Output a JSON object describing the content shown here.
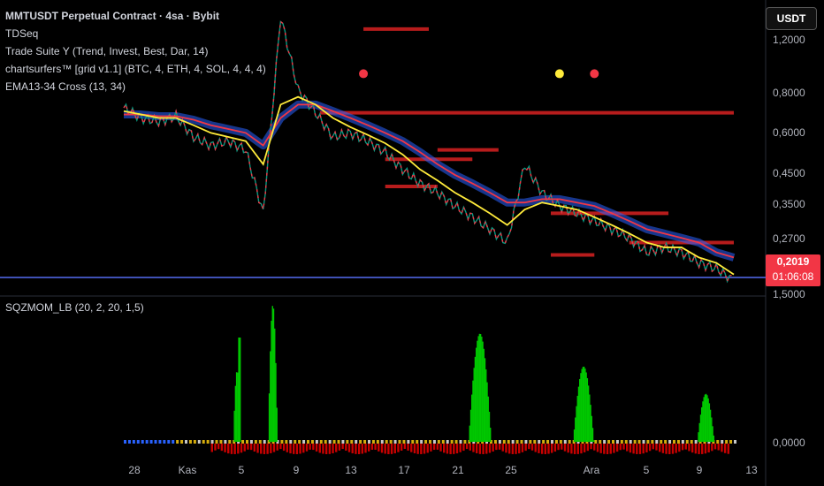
{
  "header": {
    "title": "MMTUSDT Perpetual Contract · 4sa · Bybit",
    "indicators": [
      "TDSeq",
      "Trade Suite Y (Trend, Invest, Best, Dar, 14)",
      "chartsurfers™ [grid v1.1] (BTC, 4, ETH, 4, SOL, 4, 4, 4)",
      "EMA13-34 Cross (13, 34)"
    ],
    "lower_indicator": "SQZMOM_LB (20, 2, 20, 1,5)"
  },
  "currency_button": "USDT",
  "last_price": {
    "value": "0,2019",
    "countdown": "01:06:08"
  },
  "colors": {
    "background": "#000000",
    "up": "#089981",
    "down": "#f23645",
    "ema_fast": "#ffeb3b",
    "ema_slow": "#f23645",
    "cloud": "#2962ff",
    "level": "#b71c1c",
    "mom_up": "#00c800",
    "mom_down": "#c80000",
    "squeeze_on": "#d4ac0d",
    "squeeze_off": "#c8c8c8"
  },
  "chart_data": [
    {
      "type": "line",
      "name": "price",
      "scale": "log",
      "y_ticks": [
        "1,2000",
        "0,8000",
        "0,6000",
        "0,4500",
        "0,3500",
        "0,2700",
        "1,5000"
      ],
      "x_ticks": [
        "28",
        "Kas",
        "5",
        "9",
        "13",
        "17",
        "21",
        "25",
        "Ara",
        "5",
        "9",
        "13"
      ],
      "x": [
        0,
        4,
        8,
        12,
        16,
        20,
        24,
        28,
        32,
        36,
        40,
        44,
        48,
        52,
        56,
        60,
        64,
        68,
        72,
        76,
        80,
        84,
        88,
        92,
        96,
        100,
        104,
        108,
        112,
        116,
        120,
        124,
        128,
        132,
        136,
        140
      ],
      "close": [
        0.78,
        0.72,
        0.7,
        0.73,
        0.62,
        0.58,
        0.6,
        0.56,
        0.34,
        1.6,
        0.9,
        0.75,
        0.62,
        0.64,
        0.6,
        0.55,
        0.48,
        0.43,
        0.4,
        0.36,
        0.33,
        0.3,
        0.27,
        0.5,
        0.4,
        0.36,
        0.34,
        0.32,
        0.3,
        0.28,
        0.25,
        0.26,
        0.25,
        0.23,
        0.22,
        0.2
      ],
      "ema13": [
        0.76,
        0.74,
        0.72,
        0.72,
        0.68,
        0.64,
        0.62,
        0.6,
        0.5,
        0.8,
        0.85,
        0.8,
        0.72,
        0.67,
        0.63,
        0.59,
        0.54,
        0.48,
        0.44,
        0.4,
        0.37,
        0.34,
        0.31,
        0.35,
        0.37,
        0.36,
        0.35,
        0.33,
        0.31,
        0.29,
        0.27,
        0.26,
        0.26,
        0.24,
        0.23,
        0.21
      ],
      "ema34": [
        0.74,
        0.74,
        0.73,
        0.73,
        0.71,
        0.68,
        0.66,
        0.64,
        0.58,
        0.72,
        0.8,
        0.8,
        0.76,
        0.72,
        0.68,
        0.64,
        0.6,
        0.55,
        0.5,
        0.46,
        0.43,
        0.4,
        0.37,
        0.37,
        0.38,
        0.38,
        0.37,
        0.36,
        0.34,
        0.32,
        0.3,
        0.29,
        0.28,
        0.27,
        0.25,
        0.24
      ],
      "levels": [
        {
          "y": 1.45,
          "x0": 55,
          "x1": 70
        },
        {
          "y": 0.75,
          "x0": 45,
          "x1": 140
        },
        {
          "y": 0.56,
          "x0": 72,
          "x1": 86
        },
        {
          "y": 0.52,
          "x0": 60,
          "x1": 80
        },
        {
          "y": 0.42,
          "x0": 60,
          "x1": 72
        },
        {
          "y": 0.34,
          "x0": 98,
          "x1": 125
        },
        {
          "y": 0.27,
          "x0": 116,
          "x1": 140
        },
        {
          "y": 0.245,
          "x0": 98,
          "x1": 108
        }
      ],
      "markers": [
        {
          "x": 55,
          "y": 1.02,
          "color": "#f23645"
        },
        {
          "x": 100,
          "y": 1.02,
          "color": "#ffeb3b"
        },
        {
          "x": 108,
          "y": 1.02,
          "color": "#f23645"
        }
      ]
    },
    {
      "type": "bar",
      "name": "SQZMOM_LB",
      "y_ticks": [
        "0,0000"
      ],
      "segments": [
        {
          "x0": 100,
          "x1": 108,
          "peak": 0.52,
          "color": "up"
        },
        {
          "x0": 132,
          "x1": 142,
          "peak": 1.0,
          "color": "up"
        },
        {
          "x0": 316,
          "x1": 340,
          "peak": 0.79,
          "color": "up"
        },
        {
          "x0": 412,
          "x1": 434,
          "peak": 0.55,
          "color": "up"
        },
        {
          "x0": 526,
          "x1": 544,
          "peak": 0.35,
          "color": "up"
        }
      ]
    }
  ]
}
